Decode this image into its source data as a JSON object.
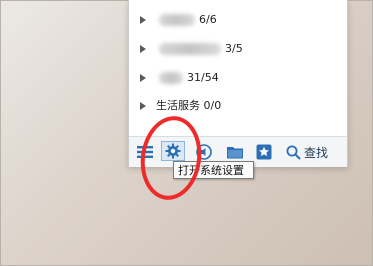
{
  "groups": [
    {
      "label_visible": "6/6"
    },
    {
      "label_visible": "3/5"
    },
    {
      "label_visible": "31/54"
    },
    {
      "label_visible": "生活服务 0/0"
    }
  ],
  "toolbar": {
    "menu_icon": "menu-icon",
    "settings_icon": "gear-icon",
    "sound_icon": "sound-icon",
    "folder_icon": "folder-icon",
    "star_icon": "star-icon",
    "find_icon": "search-icon",
    "find_label": "查找"
  },
  "tooltip": {
    "text": "打开系统设置"
  },
  "annotation": {
    "color": "#ee2a2a"
  }
}
